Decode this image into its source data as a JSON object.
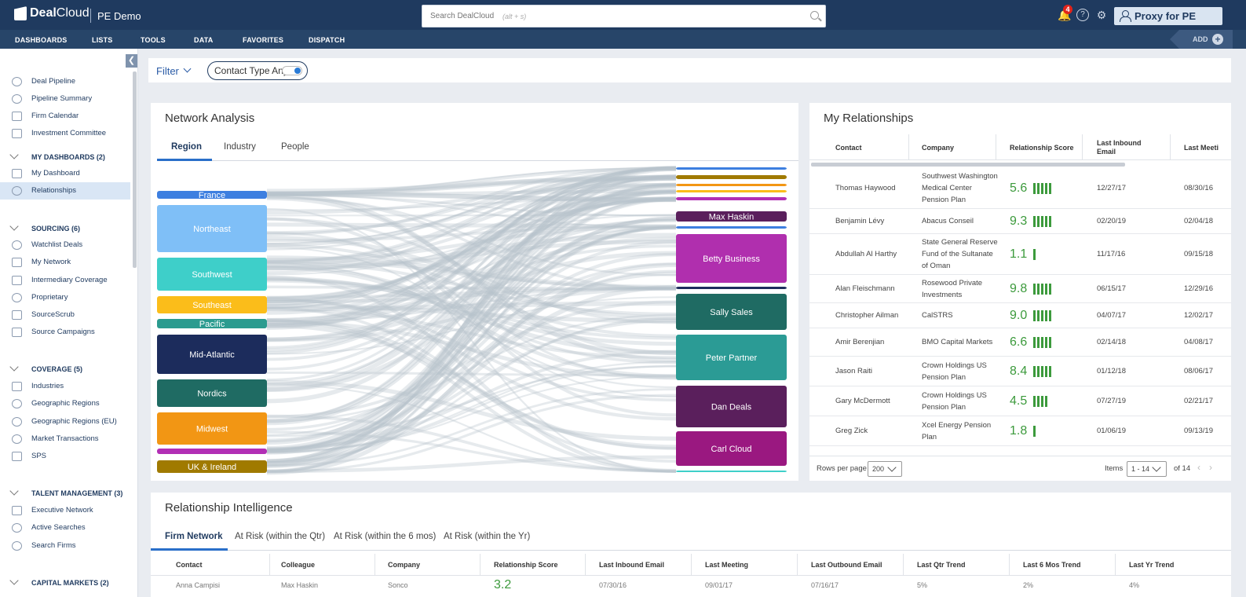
{
  "app": {
    "brand_a": "Deal",
    "brand_b": "Cloud",
    "env": "PE Demo"
  },
  "search": {
    "placeholder": "Search DealCloud",
    "hint": "(alt + s)"
  },
  "topbar": {
    "notification_count": "4",
    "help": "?",
    "user": "Proxy for PE Demo"
  },
  "nav": {
    "items": [
      "DASHBOARDS",
      "LISTS",
      "TOOLS",
      "DATA",
      "FAVORITES",
      "DISPATCH"
    ],
    "add": "ADD"
  },
  "sidebar": {
    "top": [
      "Deal Pipeline",
      "Pipeline Summary",
      "Firm Calendar",
      "Investment Committee"
    ],
    "my_dashboards": {
      "title": "MY DASHBOARDS (2)",
      "items": [
        "My Dashboard",
        "Relationships"
      ]
    },
    "sourcing": {
      "title": "SOURCING (6)",
      "items": [
        "Watchlist Deals",
        "My Network",
        "Intermediary Coverage",
        "Proprietary",
        "SourceScrub",
        "Source Campaigns"
      ]
    },
    "coverage": {
      "title": "COVERAGE (5)",
      "items": [
        "Industries",
        "Geographic Regions",
        "Geographic Regions (EU)",
        "Market Transactions",
        "SPS"
      ]
    },
    "talent": {
      "title": "TALENT MANAGEMENT (3)",
      "items": [
        "Executive Network",
        "Active Searches",
        "Search Firms"
      ]
    },
    "capital": {
      "title": "CAPITAL MARKETS (2)"
    }
  },
  "filterbar": {
    "filter": "Filter",
    "contact_type": "Contact Type Any"
  },
  "network": {
    "title": "Network Analysis",
    "tabs": [
      "Region",
      "Industry",
      "People"
    ],
    "left_nodes": [
      {
        "label": "France",
        "color": "#3d7fe0"
      },
      {
        "label": "Northeast",
        "color": "#7fbff7"
      },
      {
        "label": "Southwest",
        "color": "#3ecfc9"
      },
      {
        "label": "Southeast",
        "color": "#fbbd1a"
      },
      {
        "label": "Pacific",
        "color": "#2b9b8f"
      },
      {
        "label": "Mid-Atlantic",
        "color": "#1c2c5c"
      },
      {
        "label": "Nordics",
        "color": "#1f6b63"
      },
      {
        "label": "Midwest",
        "color": "#f29614"
      },
      {
        "label": "",
        "color": "#b22fb5"
      },
      {
        "label": "UK & Ireland",
        "color": "#a07a00"
      }
    ],
    "right_nodes": [
      {
        "label": "",
        "color": "#3d7fe0"
      },
      {
        "label": "",
        "color": "#a07a00"
      },
      {
        "label": "",
        "color": "#f29614"
      },
      {
        "label": "",
        "color": "#fbbd1a"
      },
      {
        "label": "",
        "color": "#b22fb5"
      },
      {
        "label": "Max Haskin",
        "color": "#5a1f5c"
      },
      {
        "label": "",
        "color": "#3d7fe0"
      },
      {
        "label": "Betty Business",
        "color": "#b02fae"
      },
      {
        "label": "",
        "color": "#1c2c5c"
      },
      {
        "label": "Sally Sales",
        "color": "#1f6b63"
      },
      {
        "label": "Peter Partner",
        "color": "#2b9b95"
      },
      {
        "label": "Dan Deals",
        "color": "#5a1f5c"
      },
      {
        "label": "Carl Cloud",
        "color": "#9a1880"
      },
      {
        "label": "",
        "color": "#3ecfc9"
      }
    ]
  },
  "relationships": {
    "title": "My Relationships",
    "columns": [
      "Contact",
      "Company",
      "Relationship Score",
      "Last Inbound Email",
      "Last Meeti"
    ],
    "rows": [
      {
        "contact": "Thomas Haywood",
        "company": "Southwest Washington Medical Center Pension Plan",
        "score": "5.6",
        "bars": 5,
        "inbound": "12/27/17",
        "meeting": "08/30/16"
      },
      {
        "contact": "Benjamin Lévy",
        "company": "Abacus Conseil",
        "score": "9.3",
        "bars": 5,
        "inbound": "02/20/19",
        "meeting": "02/04/18"
      },
      {
        "contact": "Abdullah Al Harthy",
        "company": "State General Reserve Fund of the Sultanate of Oman",
        "score": "1.1",
        "bars": 1,
        "inbound": "11/17/16",
        "meeting": "09/15/18"
      },
      {
        "contact": "Alan Fleischmann",
        "company": "Rosewood Private Investments",
        "score": "9.8",
        "bars": 5,
        "inbound": "06/15/17",
        "meeting": "12/29/16"
      },
      {
        "contact": "Christopher Ailman",
        "company": "CalSTRS",
        "score": "9.0",
        "bars": 5,
        "inbound": "04/07/17",
        "meeting": "12/02/17"
      },
      {
        "contact": "Amir Berenjian",
        "company": "BMO Capital Markets",
        "score": "6.6",
        "bars": 5,
        "inbound": "02/14/18",
        "meeting": "04/08/17"
      },
      {
        "contact": "Jason Raiti",
        "company": "Crown Holdings US Pension Plan",
        "score": "8.4",
        "bars": 5,
        "inbound": "01/12/18",
        "meeting": "08/06/17"
      },
      {
        "contact": "Gary McDermott",
        "company": "Crown Holdings US Pension Plan",
        "score": "4.5",
        "bars": 4,
        "inbound": "07/27/19",
        "meeting": "02/21/17"
      },
      {
        "contact": "Greg Zick",
        "company": "Xcel Energy Pension Plan",
        "score": "1.8",
        "bars": 1,
        "inbound": "01/06/19",
        "meeting": "09/13/19"
      }
    ],
    "footer": {
      "rows_label": "Rows per page",
      "rows_value": "200",
      "items_label": "Items",
      "items_value": "1 - 14",
      "of": "of 14"
    }
  },
  "intelligence": {
    "title": "Relationship Intelligence",
    "tabs": [
      "Firm Network",
      "At Risk (within the Qtr)",
      "At Risk (within the 6 mos)",
      "At Risk (within the Yr)"
    ],
    "columns": [
      "Contact",
      "Colleague",
      "Company",
      "Relationship Score",
      "Last Inbound Email",
      "Last Meeting",
      "Last Outbound Email",
      "Last Qtr Trend",
      "Last 6 Mos Trend",
      "Last Yr Trend"
    ],
    "row": [
      "Anna Campisi",
      "Max Haskin",
      "Sonco",
      "3.2",
      "07/30/16",
      "09/01/17",
      "07/16/17",
      "5%",
      "2%",
      "4%"
    ]
  },
  "colors": {
    "accent": "#2a6fc9",
    "score_green": "#3c9a3c",
    "topbar": "#1f3a5f"
  }
}
